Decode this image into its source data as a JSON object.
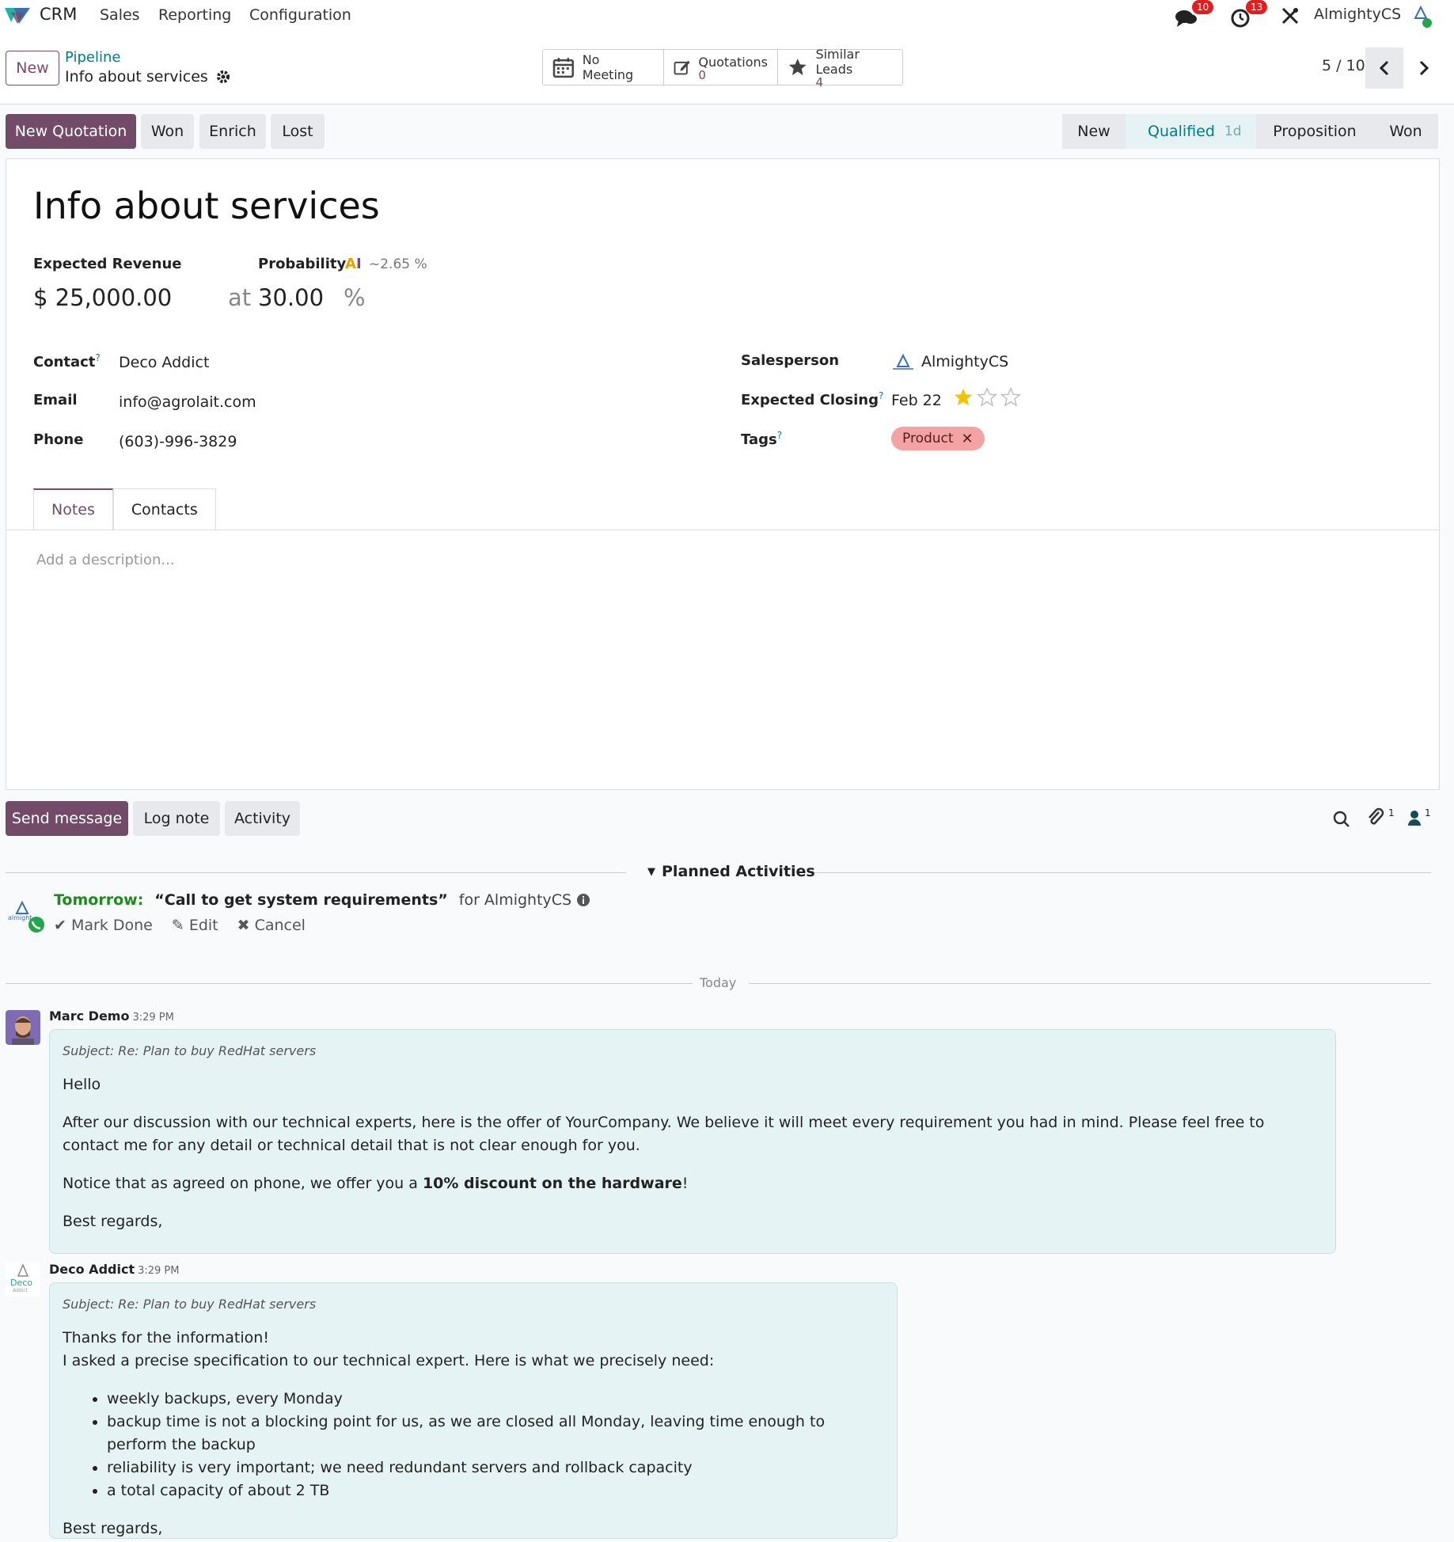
{
  "navbar": {
    "app_name": "CRM",
    "menus": [
      "Sales",
      "Reporting",
      "Configuration"
    ],
    "messages_count": "10",
    "activities_count": "13",
    "user_name": "AlmightyCS"
  },
  "control": {
    "new_button": "New",
    "breadcrumb_parent": "Pipeline",
    "breadcrumb_current": "Info about services",
    "smart_buttons": {
      "meeting": "No Meeting",
      "quotations_label": "Quotations",
      "quotations_count": "0",
      "similar_label": "Similar Leads",
      "similar_count": "4"
    },
    "pager": "5 / 10"
  },
  "actions": {
    "new_quotation": "New Quotation",
    "won": "Won",
    "enrich": "Enrich",
    "lost": "Lost"
  },
  "stages": [
    {
      "name": "New",
      "duration": ""
    },
    {
      "name": "Qualified",
      "duration": "1d"
    },
    {
      "name": "Proposition",
      "duration": ""
    },
    {
      "name": "Won",
      "duration": ""
    }
  ],
  "record": {
    "title": "Info about services",
    "expected_revenue_label": "Expected Revenue",
    "expected_revenue": "$ 25,000.00",
    "probability_label": "Probability",
    "ai_probability": "~2.65 %",
    "at": "at",
    "probability": "30.00",
    "percent": "%",
    "contact_label": "Contact",
    "contact": "Deco Addict",
    "email_label": "Email",
    "email": "info@agrolait.com",
    "phone_label": "Phone",
    "phone": "(603)-996-3829",
    "salesperson_label": "Salesperson",
    "salesperson": "AlmightyCS",
    "expected_closing_label": "Expected Closing",
    "expected_closing": "Feb 22",
    "priority_stars": 1,
    "priority_max": 3,
    "tags_label": "Tags",
    "tag": "Product",
    "help_mark": "?"
  },
  "tabs": [
    "Notes",
    "Contacts"
  ],
  "notes": {
    "placeholder": "Add a description..."
  },
  "chatter": {
    "send_message": "Send message",
    "log_note": "Log note",
    "activity": "Activity",
    "attachments_count": "1",
    "followers_count": "1",
    "planned_activities": "Planned Activities",
    "activity_when": "Tomorrow:",
    "activity_summary": "“Call to get system requirements”",
    "activity_for": "for AlmightyCS",
    "mark_done": "Mark Done",
    "edit": "Edit",
    "cancel": "Cancel",
    "today": "Today",
    "messages": [
      {
        "author": "Marc Demo",
        "time": "3:29 PM",
        "subject": "Subject: Re: Plan to buy RedHat servers",
        "greeting": "Hello",
        "body1": "After our discussion with our technical experts, here is the offer of YourCompany. We believe it will meet every requirement you had in mind. Please feel free to contact me for any detail or technical detail that is not clear enough for you.",
        "body2_pre": "Notice that as agreed on phone, we offer you a ",
        "body2_bold": "10% discount on the hardware",
        "body2_post": "!",
        "closing": "Best regards,"
      },
      {
        "author": "Deco Addict",
        "time": "3:29 PM",
        "subject": "Subject: Re: Plan to buy RedHat servers",
        "line1": "Thanks for the information!",
        "line2": "I asked a precise specification to our technical expert. Here is what we precisely need:",
        "items": [
          "weekly backups, every Monday",
          "backup time is not a blocking point for us, as we are closed all Monday, leaving time enough to perform the backup",
          "reliability is very important; we need redundant servers and rollback capacity",
          "a total capacity of about 2 TB"
        ],
        "closing": "Best regards,"
      }
    ]
  },
  "colors": {
    "brand": "#714b67",
    "teal": "#017e84",
    "tag": "#f3a3a3",
    "bubble": "#e6f3f4"
  }
}
